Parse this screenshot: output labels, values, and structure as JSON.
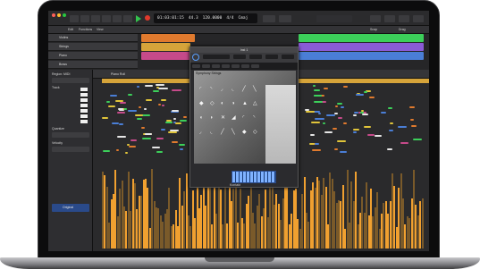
{
  "control_bar": {
    "lcd_position": "01:03:01:15",
    "lcd_bars": "44.3",
    "lcd_tempo": "120.0000",
    "lcd_sig": "4/4",
    "lcd_key": "Cmaj"
  },
  "toolbar": {
    "edit": "Edit",
    "functions": "Functions",
    "view": "View",
    "snap": "Snap",
    "drag": "Drag"
  },
  "tracks": [
    {
      "label": "Violins"
    },
    {
      "label": "Strings"
    },
    {
      "label": "Piano"
    },
    {
      "label": "Brass"
    }
  ],
  "inspector": {
    "region_label": "Region: MIDI",
    "track_label": "Track",
    "quantize_label": "Quantize",
    "velocity_label": "Velocity",
    "preset_label": "Original"
  },
  "editor": {
    "title": "Piano Roll"
  },
  "plugin": {
    "title": "Inst 1",
    "instrument_name": "Symphony Strings",
    "keyboard_label": "Kontakt"
  },
  "colors": {
    "region_orange": "#e07a2e",
    "region_green": "#3ccf5a",
    "region_purple": "#8a5bd6",
    "velocity": "#f0a030",
    "accent_blue": "#5aa0ff"
  }
}
